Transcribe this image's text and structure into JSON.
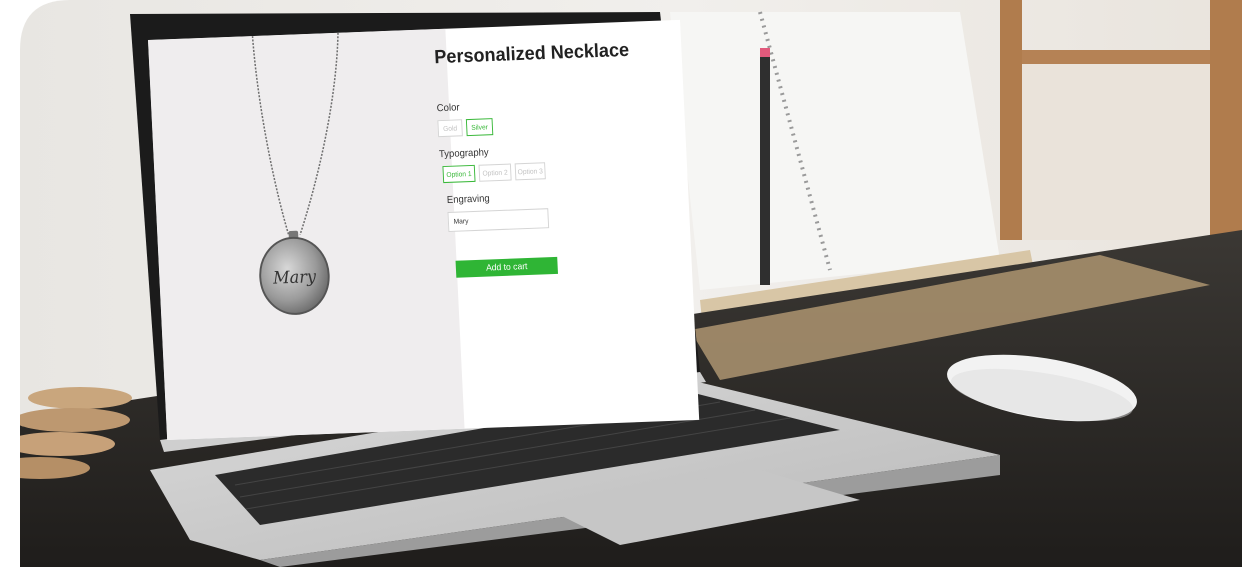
{
  "product": {
    "title": "Personalized Necklace",
    "pendant_text": "Mary"
  },
  "color": {
    "label": "Color",
    "options": [
      "Gold",
      "Silver"
    ],
    "selected": "Silver"
  },
  "typography": {
    "label": "Typography",
    "options": [
      "Option 1",
      "Option 2",
      "Option 3"
    ],
    "selected": "Option 1"
  },
  "engraving": {
    "label": "Engraving",
    "value": "Mary"
  },
  "cart": {
    "label": "Add to cart"
  },
  "colors": {
    "accent": "#2fb535",
    "desk": "#2c2a27",
    "wall": "#ece9e4"
  }
}
